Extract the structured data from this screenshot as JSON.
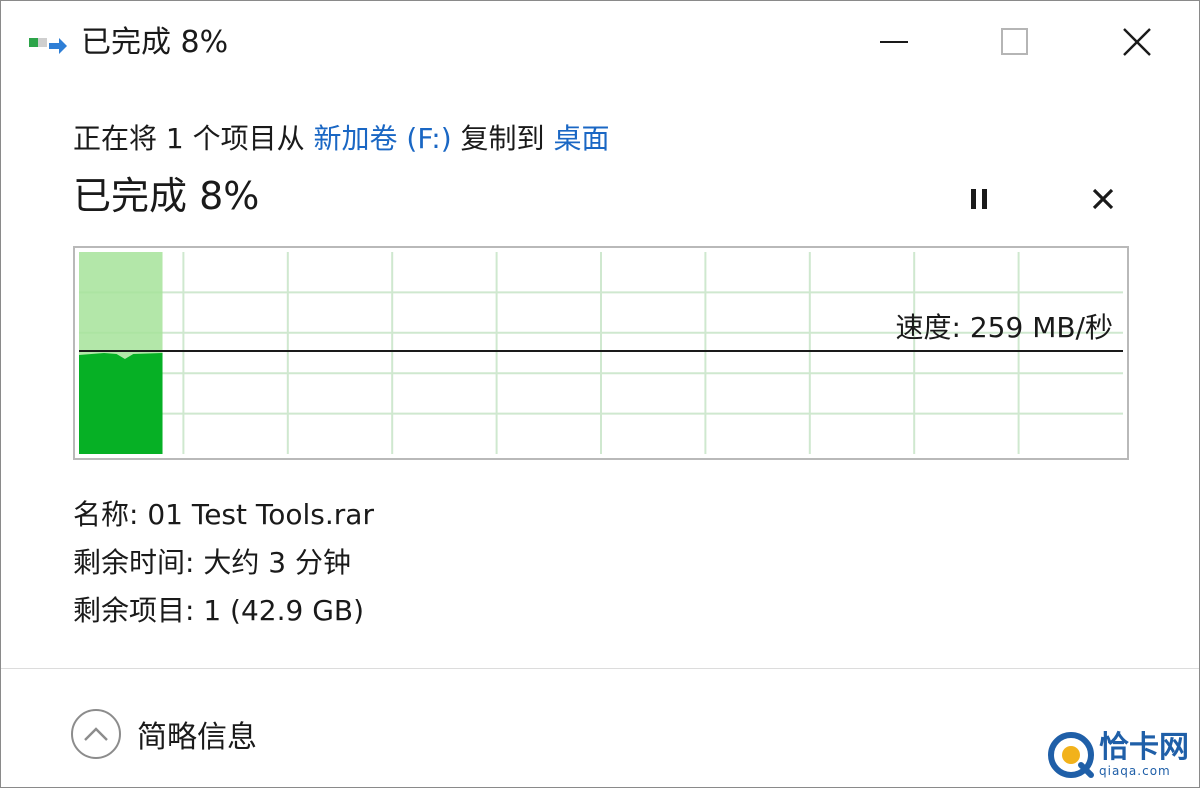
{
  "window": {
    "title": "已完成 8%",
    "icon": "file-copy-icon"
  },
  "caption_buttons": {
    "minimize": "minimize-icon",
    "maximize": "maximize-icon",
    "close": "close-icon"
  },
  "copy_status": {
    "prefix": "正在将 1 个项目从 ",
    "source": "新加卷 (F:)",
    "middle": " 复制到 ",
    "destination": "桌面"
  },
  "progress": {
    "heading": "已完成 8%",
    "percent": 8,
    "pause_icon": "pause-icon",
    "cancel_icon": "cancel-icon"
  },
  "graph": {
    "speed_label": "速度: 259 MB/秒",
    "speed_line_level": 0.49,
    "filled_fraction": 0.08,
    "fill_color": "#06b025",
    "fill_light_color": "#a6e39a",
    "grid_color": "#cfe8cf",
    "line_color": "#1a1a1a"
  },
  "details": {
    "name": "名称: 01 Test Tools.rar",
    "time_remaining": "剩余时间: 大约 3 分钟",
    "items_remaining": "剩余项目: 1 (42.9 GB)"
  },
  "footer": {
    "toggle_label": "简略信息",
    "toggle_icon": "chevron-up-icon"
  },
  "watermark": {
    "name": "恰卡网",
    "domain": "qiaqa.com"
  }
}
